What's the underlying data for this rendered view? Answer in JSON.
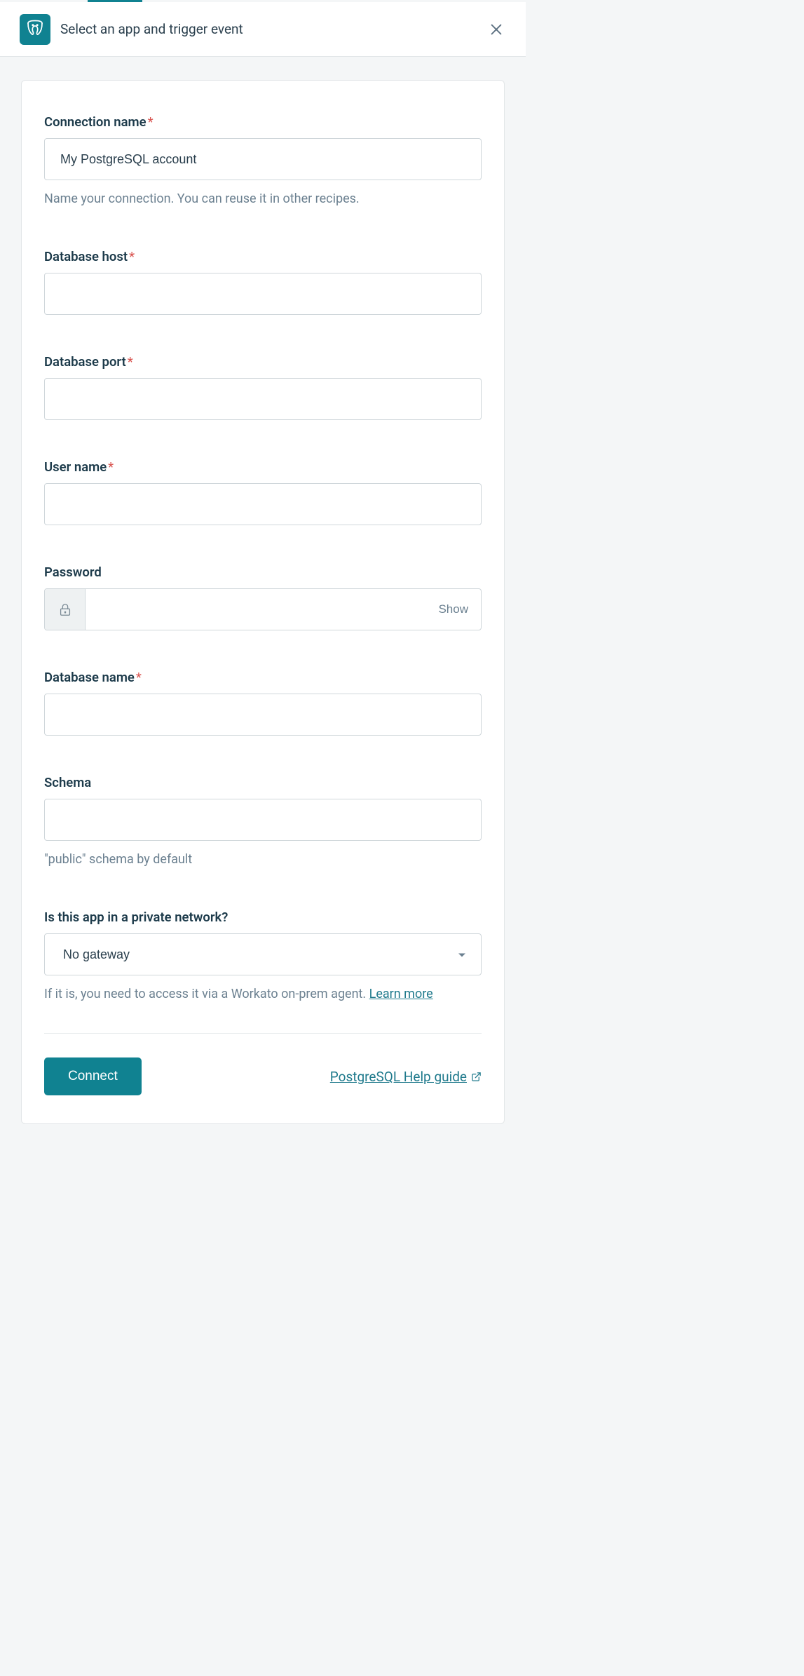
{
  "header": {
    "title": "Select an app and trigger event"
  },
  "fields": {
    "connection_name": {
      "label": "Connection name",
      "required_mark": "*",
      "value": "My PostgreSQL account",
      "helper": "Name your connection. You can reuse it in other recipes."
    },
    "database_host": {
      "label": "Database host",
      "required_mark": "*",
      "value": ""
    },
    "database_port": {
      "label": "Database port",
      "required_mark": "*",
      "value": ""
    },
    "user_name": {
      "label": "User name",
      "required_mark": "*",
      "value": ""
    },
    "password": {
      "label": "Password",
      "value": "",
      "show_label": "Show"
    },
    "database_name": {
      "label": "Database name",
      "required_mark": "*",
      "value": ""
    },
    "schema": {
      "label": "Schema",
      "value": "",
      "helper": "\"public\" schema by default"
    },
    "private_network": {
      "label": "Is this app in a private network?",
      "value": "No gateway",
      "helper_prefix": "If it is, you need to access it via a Workato on-prem agent. ",
      "helper_link": "Learn more"
    }
  },
  "footer": {
    "connect_label": "Connect",
    "help_link_label": "PostgreSQL Help guide"
  },
  "colors": {
    "accent": "#108291",
    "link": "#1f7a8c",
    "text": "#1c3a4a",
    "muted": "#6b8090",
    "danger": "#d9534f"
  }
}
